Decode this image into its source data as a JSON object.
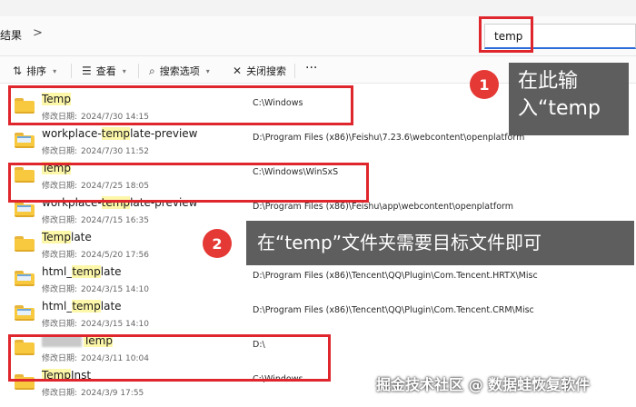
{
  "address": {
    "breadcrumb": "结果",
    "separator": ">"
  },
  "search": {
    "value": "temp"
  },
  "toolbar": {
    "sort": "排序",
    "view": "查看",
    "search_options": "搜索选项",
    "close_search": "关闭搜索",
    "more": "···"
  },
  "rows": [
    {
      "pre": "",
      "hl": "Temp",
      "post": "",
      "date_label": "修改日期:",
      "date": "2024/7/30 14:15",
      "path": "C:\\Windows",
      "icon": "folder-icon"
    },
    {
      "pre": "workplace-",
      "hl": "temp",
      "post": "late-preview",
      "date_label": "修改日期:",
      "date": "2024/7/30 11:52",
      "path": "D:\\Program Files (x86)\\Feishu\\7.23.6\\webcontent\\openplatform",
      "icon": "document-folder-icon"
    },
    {
      "pre": "",
      "hl": "Temp",
      "post": "",
      "date_label": "修改日期:",
      "date": "2024/7/25 18:05",
      "path": "C:\\Windows\\WinSxS",
      "icon": "folder-icon"
    },
    {
      "pre": "workplace-",
      "hl": "temp",
      "post": "late-preview",
      "date_label": "修改日期:",
      "date": "2024/7/15 16:35",
      "path": "D:\\Program Files (x86)\\Feishu\\app\\webcontent\\openplatform",
      "icon": "document-folder-icon"
    },
    {
      "pre": "",
      "hl": "Temp",
      "post": "late",
      "date_label": "修改日期:",
      "date": "2024/5/20 17:56",
      "path": "",
      "icon": "folder-icon"
    },
    {
      "pre": "html_",
      "hl": "temp",
      "post": "late",
      "date_label": "修改日期:",
      "date": "2024/3/15 14:10",
      "path": "D:\\Program Files (x86)\\Tencent\\QQ\\Plugin\\Com.Tencent.HRTX\\Misc",
      "icon": "document-folder-icon"
    },
    {
      "pre": "html_",
      "hl": "temp",
      "post": "late",
      "date_label": "修改日期:",
      "date": "2024/3/15 14:10",
      "path": "D:\\Program Files (x86)\\Tencent\\QQ\\Plugin\\Com.Tencent.CRM\\Misc",
      "icon": "document-folder-icon"
    },
    {
      "pre": "",
      "hl": "Temp",
      "post": "",
      "date_label": "修改日期:",
      "date": "2024/3/11 10:04",
      "path": "D:\\",
      "icon": "folder-icon",
      "blurred_prefix": true
    },
    {
      "pre": "",
      "hl": "Temp",
      "post": "Inst",
      "date_label": "修改日期:",
      "date": "2024/3/9 17:55",
      "path": "C:\\Windows",
      "icon": "folder-icon"
    }
  ],
  "annotations": {
    "badge1": "1",
    "callout1": "在此输入“temp",
    "badge2": "2",
    "callout2": "在“temp”文件夹需要目标文件即可"
  },
  "watermark": "掘金技术社区 @ 数据蛙恢复软件",
  "colors": {
    "highlight": "#fdf7a9",
    "annotation_red": "#e0262d",
    "folder": "#f8c93f",
    "search_accent": "#2b6cd8"
  }
}
